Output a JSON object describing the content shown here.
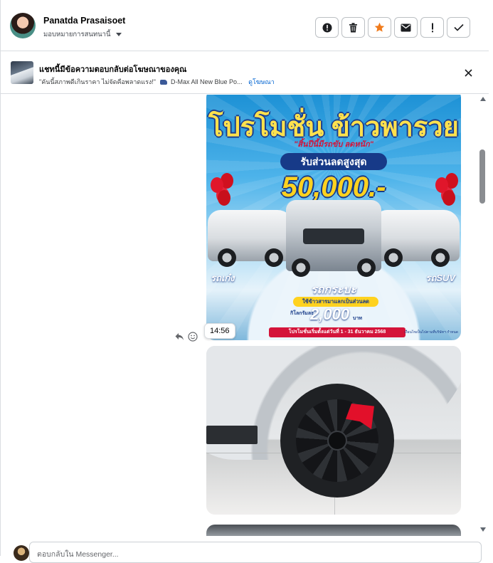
{
  "header": {
    "contact_name": "Panatda Prasaisoet",
    "assign_label": "มอบหมายการสนทนานี้",
    "avatar_icon": "user-avatar",
    "actions": [
      {
        "name": "report-spam-button",
        "icon": "alert-circle-icon"
      },
      {
        "name": "delete-button",
        "icon": "trash-icon"
      },
      {
        "name": "star-button",
        "icon": "star-icon",
        "accent": "#f07b1c"
      },
      {
        "name": "mark-unread-button",
        "icon": "envelope-icon"
      },
      {
        "name": "follow-up-button",
        "icon": "exclamation-icon"
      },
      {
        "name": "mark-done-button",
        "icon": "check-icon"
      }
    ]
  },
  "ad_banner": {
    "title": "แชทนี้มีข้อความตอบกลับต่อโฆษณาของคุณ",
    "snippet": "\"คันนี้สภาพดีเกินราคา ไม่จัดคือพลาดแรง!\"",
    "car_icon": "car-emoji",
    "ad_name": "D-Max All New Blue Po...",
    "link_label": "ดูโฆษณา",
    "close_icon": "close-icon"
  },
  "messages": {
    "promo_image": {
      "title": "โปรโมชั่น ข้าวพารวย",
      "subtitle": "\"สิ้นปีนี้มีรถขับ ลดหนัก\"",
      "pill": "รับส่วนลดสูงสุด",
      "amount": "50,000.-",
      "label_left": "รถเก๋ง",
      "label_right": "รถSUV",
      "label_pickup": "รถกระบะ",
      "note": "ใช้ข้าวสารมาแลกเป็นส่วนลด",
      "km_label": "กิโลกรัมละ",
      "km_value": "2,000",
      "km_unit": "บาท",
      "date_text": "โปรโมชั่นเริ่มตั้งแต่วันที่ 1 - 31 ธันวาคม 2568",
      "fine_print": "เงื่อนไขเป็นไปตามที่บริษัทฯ กำหนด"
    },
    "timestamp": "14:56",
    "reply_icon": "reply-arrow-icon",
    "react_icon": "smiley-icon",
    "wheel_photo": "wheel-photo",
    "third_photo": "interior-photo"
  },
  "composer": {
    "placeholder": "ตอบกลับใน Messenger..."
  },
  "colors": {
    "border": "#dadde1",
    "link": "#0064d1",
    "star": "#f07b1c"
  }
}
